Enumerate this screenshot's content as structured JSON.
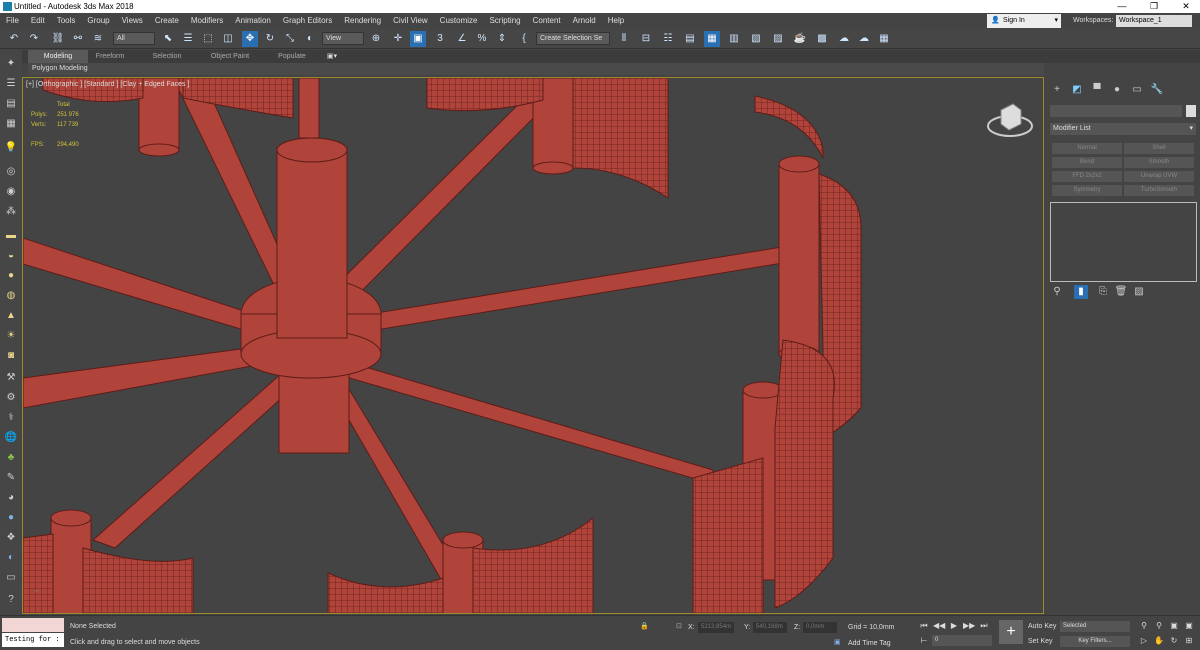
{
  "window": {
    "title": "Untitled - Autodesk 3ds Max 2018",
    "minimize": "—",
    "maximize": "❐",
    "close": "✕"
  },
  "menu": [
    "File",
    "Edit",
    "Tools",
    "Group",
    "Views",
    "Create",
    "Modifiers",
    "Animation",
    "Graph Editors",
    "Rendering",
    "Civil View",
    "Customize",
    "Scripting",
    "Content",
    "Arnold",
    "Help"
  ],
  "account": {
    "sign_in": "Sign In",
    "workspaces_label": "Workspaces:",
    "workspace_value": "Workspace_1"
  },
  "toolbar": {
    "selection_filter": "All",
    "ref_coord": "View",
    "selection_set": "Create Selection Se"
  },
  "ribbon": {
    "tabs": [
      "Modeling",
      "Freeform",
      "Selection",
      "Object Paint",
      "Populate"
    ],
    "active_tab": "Modeling",
    "sub_label": "Polygon Modeling"
  },
  "viewport": {
    "label": "[+] [Orthographic ] [Standard ] [Clay + Edged Faces ]",
    "stats": {
      "total_label": "Total",
      "polys_label": "Polys:",
      "polys_value": "251 976",
      "verts_label": "Verts:",
      "verts_value": "117 739",
      "fps_label": "FPS:",
      "fps_value": "294,490"
    }
  },
  "command_panel": {
    "modifier_list": "Modifier List",
    "modifiers": [
      "Normal",
      "Shell",
      "Bend",
      "Smooth",
      "FFD 2x2x2",
      "Unwrap UVW",
      "Symmetry",
      "TurboSmooth"
    ]
  },
  "status": {
    "maxscript": "Testing for :",
    "selection": "None Selected",
    "prompt": "Click and drag to select and move objects",
    "x_label": "X:",
    "x_value": "5213,854m",
    "y_label": "Y:",
    "y_value": "540,168m",
    "z_label": "Z:",
    "z_value": "0,0mm",
    "grid": "Grid = 10,0mm",
    "add_time_tag": "Add Time Tag",
    "frame": "0",
    "auto_key": "Auto Key",
    "set_key": "Set Key",
    "key_mode": "Selected",
    "key_filters": "Key Filters..."
  },
  "colors": {
    "model": "#b0443b",
    "model_dark": "#5e1c18",
    "viewport_bg": "#444444",
    "accent": "#2b6fb3"
  }
}
